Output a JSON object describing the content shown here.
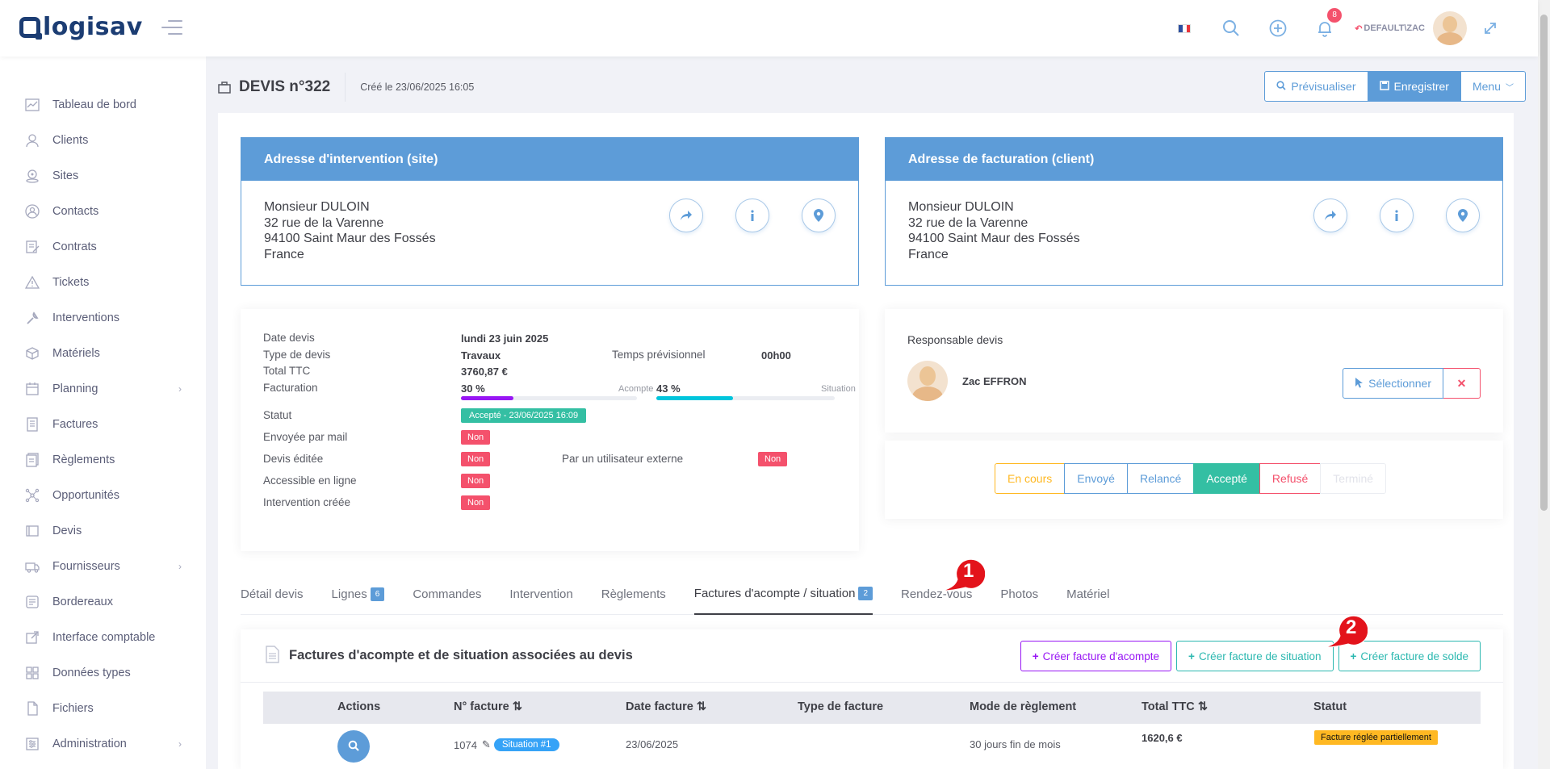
{
  "header": {
    "logo_text": "logisav",
    "user_label": "DEFAULT\\ZAC",
    "notification_count": "8"
  },
  "sidebar": {
    "items": [
      {
        "label": "Tableau de bord",
        "icon": "chart-icon"
      },
      {
        "label": "Clients",
        "icon": "users-icon"
      },
      {
        "label": "Sites",
        "icon": "location-icon"
      },
      {
        "label": "Contacts",
        "icon": "contact-icon"
      },
      {
        "label": "Contrats",
        "icon": "contract-icon"
      },
      {
        "label": "Tickets",
        "icon": "warning-icon"
      },
      {
        "label": "Interventions",
        "icon": "wrench-icon"
      },
      {
        "label": "Matériels",
        "icon": "cube-icon"
      },
      {
        "label": "Planning",
        "icon": "calendar-icon"
      },
      {
        "label": "Factures",
        "icon": "invoice-icon"
      },
      {
        "label": "Règlements",
        "icon": "payments-icon"
      },
      {
        "label": "Opportunités",
        "icon": "network-icon"
      },
      {
        "label": "Devis",
        "icon": "folder-icon"
      },
      {
        "label": "Fournisseurs",
        "icon": "truck-icon"
      },
      {
        "label": "Bordereaux",
        "icon": "stack-icon"
      },
      {
        "label": "Interface comptable",
        "icon": "external-link-icon"
      },
      {
        "label": "Données types",
        "icon": "grid-icon"
      },
      {
        "label": "Fichiers",
        "icon": "file-icon"
      },
      {
        "label": "Administration",
        "icon": "settings-icon"
      }
    ]
  },
  "subheader": {
    "title": "DEVIS n°322",
    "created": "Créé le 23/06/2025 16:05",
    "btn_preview": "Prévisualiser",
    "btn_save": "Enregistrer",
    "btn_menu": "Menu"
  },
  "intervention": {
    "title": "Adresse d'intervention (site)",
    "name": "Monsieur DULOIN",
    "street": "32 rue de la Varenne",
    "city": "94100 Saint Maur des Fossés",
    "country": "France"
  },
  "billing": {
    "title": "Adresse de facturation (client)",
    "name": "Monsieur DULOIN",
    "street": "32 rue de la Varenne",
    "city": "94100 Saint Maur des Fossés",
    "country": "France"
  },
  "info": {
    "date_label": "Date devis",
    "date_value": "lundi 23 juin 2025",
    "type_label": "Type de devis",
    "type_value": "Travaux",
    "temps_label": "Temps prévisionnel",
    "temps_value": "00h00",
    "total_label": "Total TTC",
    "total_value": "3760,87 €",
    "facturation_label": "Facturation",
    "acompte_pct": "30 %",
    "acompte_label": "Acompte",
    "acompte_fraction": 0.3,
    "situation_pct": "43 %",
    "situation_label": "Situation",
    "situation_fraction": 0.43,
    "statut_label": "Statut",
    "statut_value": "Accepté - 23/06/2025 16:09",
    "mail_label": "Envoyée par mail",
    "mail_value": "Non",
    "editee_label": "Devis éditée",
    "editee_value": "Non",
    "externe_label": "Par un utilisateur externe",
    "externe_value": "Non",
    "ligne_label": "Accessible en ligne",
    "ligne_value": "Non",
    "interv_label": "Intervention créée",
    "interv_value": "Non"
  },
  "responsable": {
    "title": "Responsable devis",
    "name": "Zac EFFRON",
    "select_label": "Sélectionner"
  },
  "status_buttons": [
    {
      "label": "En cours",
      "color": "#ffb822"
    },
    {
      "label": "Envoyé",
      "color": "#5d9cd8"
    },
    {
      "label": "Relancé",
      "color": "#5d9cd8"
    },
    {
      "label": "Accepté",
      "color": "#34bfa3"
    },
    {
      "label": "Refusé",
      "color": "#f4516c"
    },
    {
      "label": "Terminé",
      "color": "#d6d8e0"
    }
  ],
  "tabs": [
    {
      "label": "Détail devis"
    },
    {
      "label": "Lignes",
      "count": "6"
    },
    {
      "label": "Commandes"
    },
    {
      "label": "Intervention"
    },
    {
      "label": "Règlements"
    },
    {
      "label": "Factures d'acompte / situation",
      "count": "2"
    },
    {
      "label": "Rendez-vous"
    },
    {
      "label": "Photos"
    },
    {
      "label": "Matériel"
    }
  ],
  "factures": {
    "title": "Factures d'acompte et de situation associées au devis",
    "btn_acompte": "Créer facture d'acompte",
    "btn_situation": "Créer facture de situation",
    "btn_solde": "Créer facture de solde",
    "columns": [
      "Actions",
      "N° facture",
      "Date facture",
      "Type de facture",
      "Mode de règlement",
      "Total TTC",
      "Statut"
    ],
    "row": {
      "numero": "1074",
      "type_tag": "Situation  #1",
      "date": "23/06/2025",
      "mode": "30 jours fin de mois",
      "total": "1620,6 €",
      "statut": "Facture réglée partiellement"
    }
  },
  "markers": [
    "1",
    "2"
  ],
  "colors": {
    "primary": "#5d9cd8",
    "danger": "#f4516c",
    "success": "#34bfa3",
    "warning": "#ffb822",
    "purple": "#9816f4",
    "teal": "#2cb8b0"
  }
}
